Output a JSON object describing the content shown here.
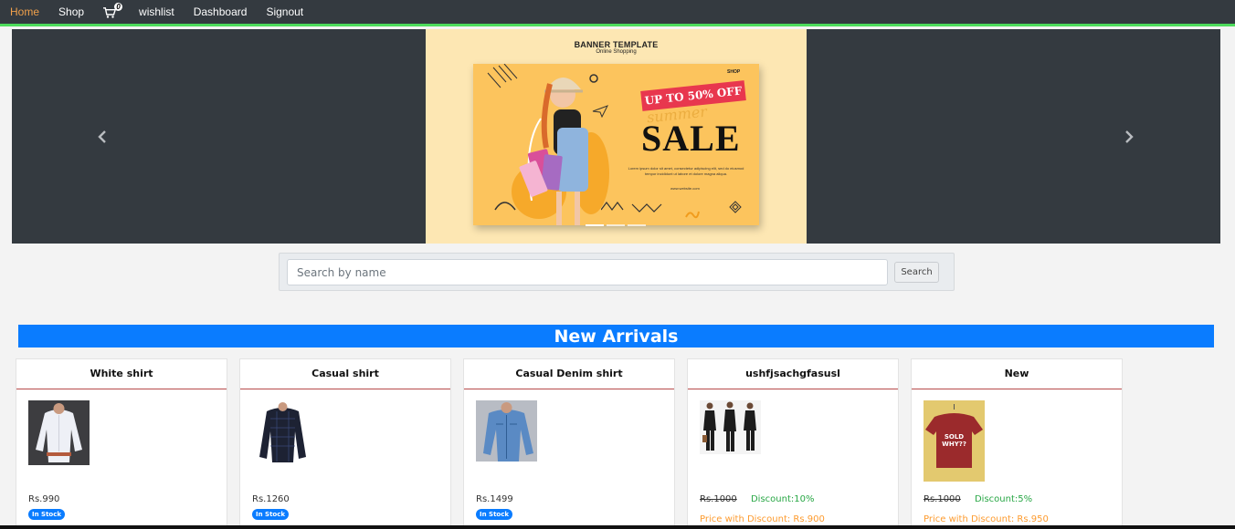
{
  "nav": {
    "items": [
      {
        "label": "Home",
        "active": true
      },
      {
        "label": "Shop"
      },
      {
        "label": "wishlist"
      },
      {
        "label": "Dashboard"
      },
      {
        "label": "Signout"
      }
    ],
    "cart_count": "0",
    "active_color": "#f0a04b"
  },
  "carousel": {
    "banner_title": "BANNER TEMPLATE",
    "banner_subtitle": "Online Shopping",
    "promo": "UP TO 50% OFF",
    "summer": "summer",
    "sale": "SALE",
    "lorem": "Lorem ipsum dolor sit amet, consectetur adipiscing elit, sed do eiusmod tempor incididunt ut labore et dolore magna aliqua.",
    "website": "www.website.com",
    "shop_logo": "SHOP",
    "slide_count": 3,
    "active_slide": 1
  },
  "search": {
    "placeholder": "Search by name",
    "button_label": "Search"
  },
  "section": {
    "title": "New Arrivals",
    "color": "#0a7cff"
  },
  "products": [
    {
      "name": "White shirt",
      "price": "Rs.990",
      "stock": "In Stock",
      "image": "white-shirt"
    },
    {
      "name": "Casual shirt",
      "price": "Rs.1260",
      "stock": "In Stock",
      "image": "casual-shirt"
    },
    {
      "name": "Casual Denim shirt",
      "price": "Rs.1499",
      "stock": "In Stock",
      "image": "denim-shirt"
    },
    {
      "name": "ushfjsachgfasusl",
      "price": "Rs.1000",
      "discount": "Discount:10%",
      "discount_price": "Price with Discount: Rs.900",
      "image": "suits"
    },
    {
      "name": "New",
      "price": "Rs.1000",
      "discount": "Discount:5%",
      "discount_price": "Price with Discount: Rs.950",
      "image": "tshirt"
    }
  ]
}
